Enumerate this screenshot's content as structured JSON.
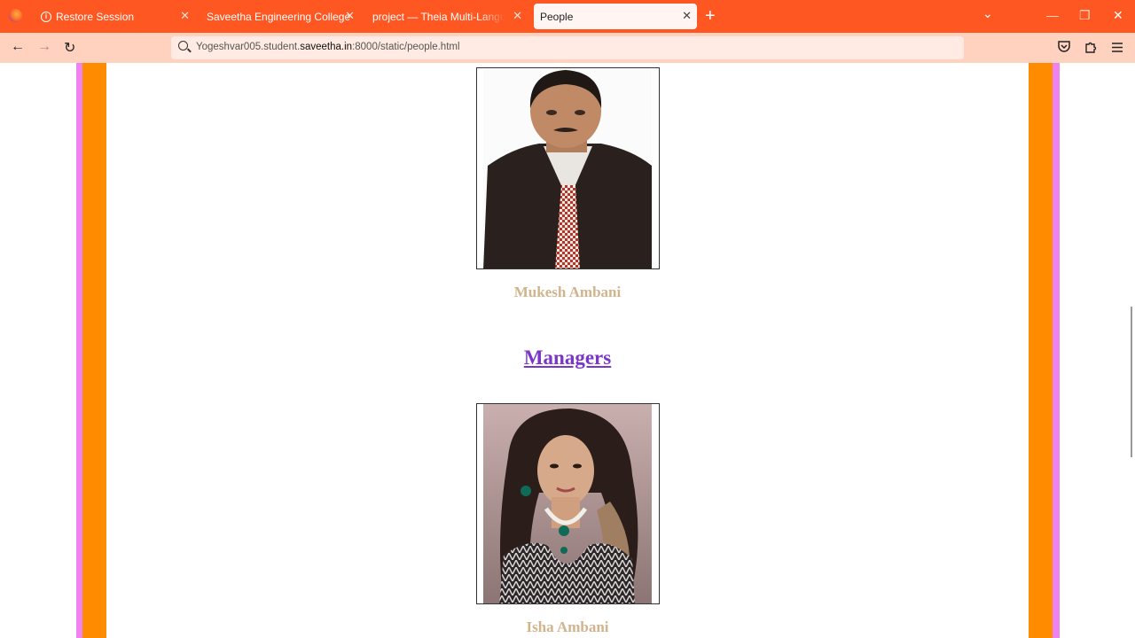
{
  "tabs": [
    {
      "label": "Restore Session",
      "active": false,
      "icon": "info-icon"
    },
    {
      "label": "Saveetha Engineering College",
      "active": false
    },
    {
      "label": "project — Theia Multi-Language Ex",
      "active": false
    },
    {
      "label": "People",
      "active": true
    }
  ],
  "nav": {
    "url_prefix": "Yogeshvar005.student.",
    "url_domain": "saveetha.in",
    "url_suffix": ":8000/static/people.html"
  },
  "page": {
    "person1": {
      "name": "Mukesh Ambani",
      "photo": "portrait of man in dark suit with red checkered tie"
    },
    "section_heading": "Managers",
    "person2": {
      "name": "Isha Ambani",
      "photo": "portrait of woman with jewelled necklace"
    }
  },
  "colors": {
    "tab_strip": "#ff5722",
    "nav_bar": "#ffd2c0",
    "violet_stripe": "#ee82ee",
    "orange_stripe": "#ff8c00",
    "name_text": "#d2b48c",
    "heading_text": "#7b35c8"
  }
}
